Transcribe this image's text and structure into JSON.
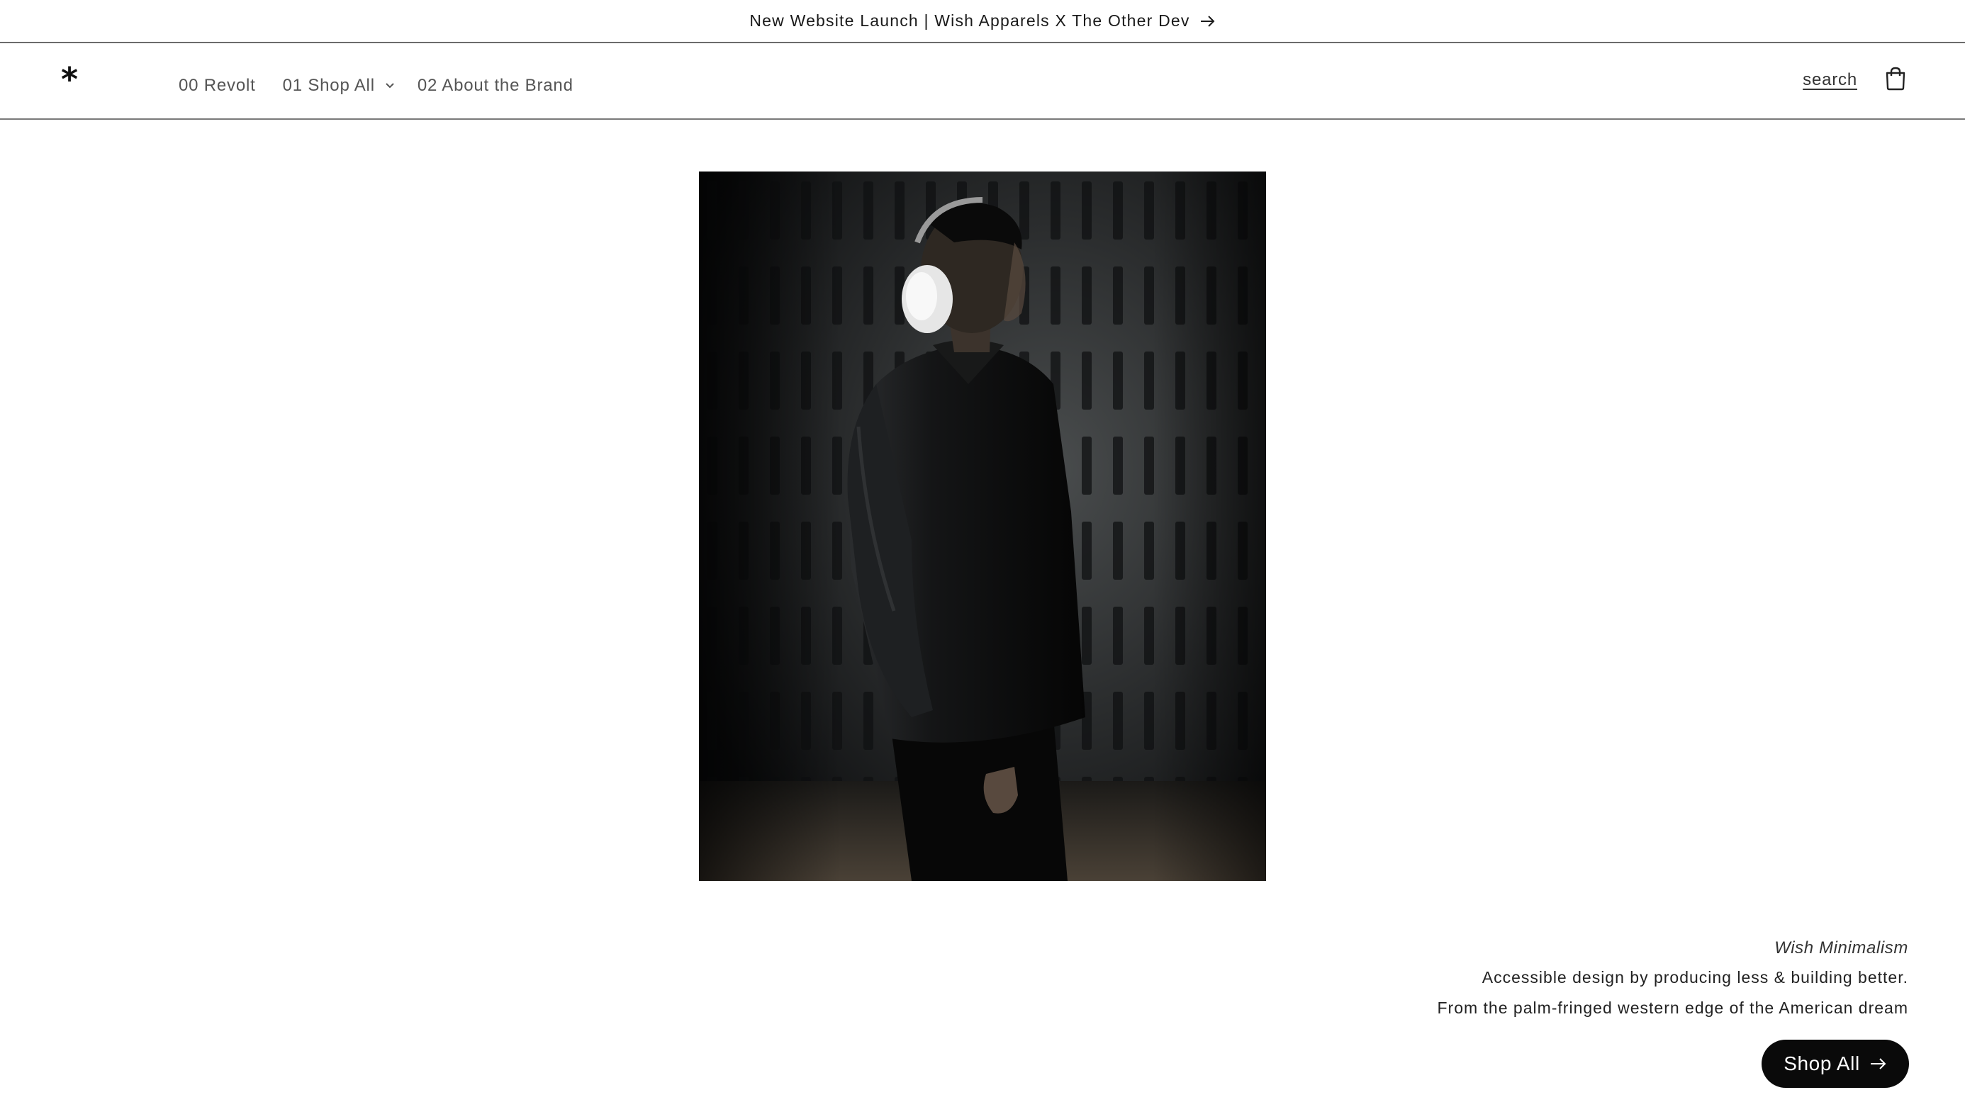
{
  "announcement": {
    "text": "New Website Launch | Wish Apparels X The Other Dev",
    "icon": "arrow-right-icon"
  },
  "header": {
    "logo": "*",
    "nav": [
      {
        "label": "00 Revolt"
      },
      {
        "label": "01 Shop All",
        "icon": "chevron-down-icon"
      },
      {
        "label": "02 About the Brand"
      }
    ],
    "search_label": "search",
    "cart_icon": "cart-icon"
  },
  "hero": {
    "image": "model-in-black-leather-jacket-with-headphones"
  },
  "feature": {
    "italic_title": "Wish Minimalism",
    "line1": "Accessible design by producing less & building better.",
    "line2": "From the palm-fringed western edge of the American dream",
    "button_label": "Shop All",
    "button_icon": "arrow-right-icon"
  },
  "colors": {
    "background": "#ffffff",
    "text": "#121212",
    "button_bg": "#0a0a0a",
    "button_text": "#ffffff"
  }
}
